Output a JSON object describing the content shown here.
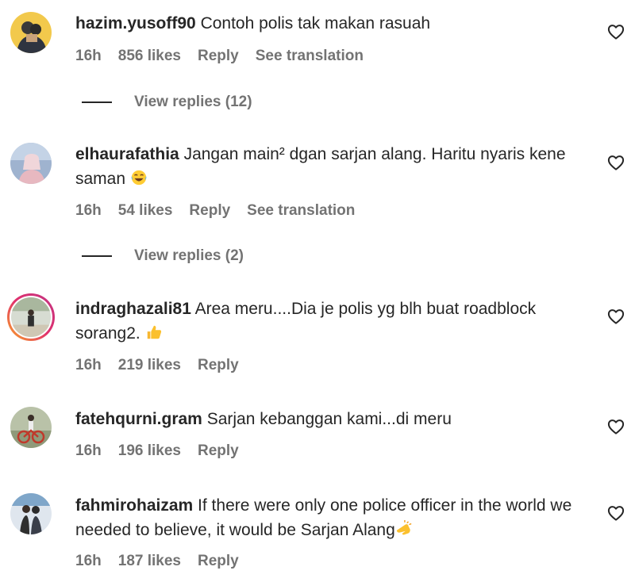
{
  "comments": [
    {
      "username": "hazim.yusoff90",
      "text": "Contoh polis tak makan rasuah",
      "time": "16h",
      "likes": "856 likes",
      "reply": "Reply",
      "translate": "See translation",
      "view_replies": "View replies (12)"
    },
    {
      "username": "elhaurafathia",
      "text": "Jangan main² dgan sarjan alang. Haritu nyaris kene saman",
      "emoji": "laughing-tears-emoji",
      "time": "16h",
      "likes": "54 likes",
      "reply": "Reply",
      "translate": "See translation",
      "view_replies": "View replies (2)"
    },
    {
      "username": "indraghazali81",
      "text": "Area meru....Dia je polis yg blh buat roadblock sorang2.",
      "emoji": "thumbs-up-emoji",
      "time": "16h",
      "likes": "219 likes",
      "reply": "Reply"
    },
    {
      "username": "fatehqurni.gram",
      "text": "Sarjan kebanggan kami...di meru",
      "time": "16h",
      "likes": "196 likes",
      "reply": "Reply"
    },
    {
      "username": "fahmirohaizam",
      "text": "If there were only one police officer in the world we needed to believe, it would be Sarjan Alang",
      "emoji": "saluting-hand-emoji",
      "time": "16h",
      "likes": "187 likes",
      "reply": "Reply"
    }
  ],
  "icons": {
    "like": "heart-outline-icon"
  },
  "colors": {
    "text": "#262626",
    "meta": "#737373",
    "background": "#ffffff",
    "story_ring": "#e1306c"
  }
}
